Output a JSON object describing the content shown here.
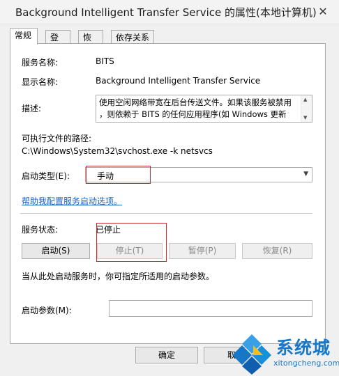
{
  "window": {
    "title": "Background Intelligent Transfer Service 的属性(本地计算机)",
    "close_icon": "close-icon"
  },
  "tabs": [
    {
      "label": "常规",
      "active": true
    },
    {
      "label": "登录",
      "active": false
    },
    {
      "label": "恢复",
      "active": false
    },
    {
      "label": "依存关系",
      "active": false
    }
  ],
  "general": {
    "service_name_label": "服务名称:",
    "service_name_value": "BITS",
    "display_name_label": "显示名称:",
    "display_name_value": "Background Intelligent Transfer Service",
    "description_label": "描述:",
    "description_line1": "使用空闲网络带宽在后台传送文件。如果该服务被禁用",
    "description_line2": "，则依赖于 BITS 的任何应用程序(如 Windows 更新",
    "exe_path_label": "可执行文件的路径:",
    "exe_path_value": "C:\\Windows\\System32\\svchost.exe -k netsvcs",
    "startup_type_label": "启动类型(E):",
    "startup_type_value": "手动",
    "help_link": "帮助我配置服务启动选项。",
    "status_label": "服务状态:",
    "status_value": "已停止",
    "start_button": "启动(S)",
    "stop_button": "停止(T)",
    "pause_button": "暂停(P)",
    "resume_button": "恢复(R)",
    "hint_text": "当从此处启动服务时，你可指定所适用的启动参数。",
    "start_params_label": "启动参数(M):",
    "start_params_value": ""
  },
  "footer": {
    "ok_button": "确定",
    "cancel_button": "取"
  },
  "watermark": {
    "text": "系统城",
    "url": "xitongcheng.com"
  },
  "colors": {
    "highlight_box": "#cc2b2b",
    "link": "#1a64c8",
    "watermark": "#1977c9"
  }
}
